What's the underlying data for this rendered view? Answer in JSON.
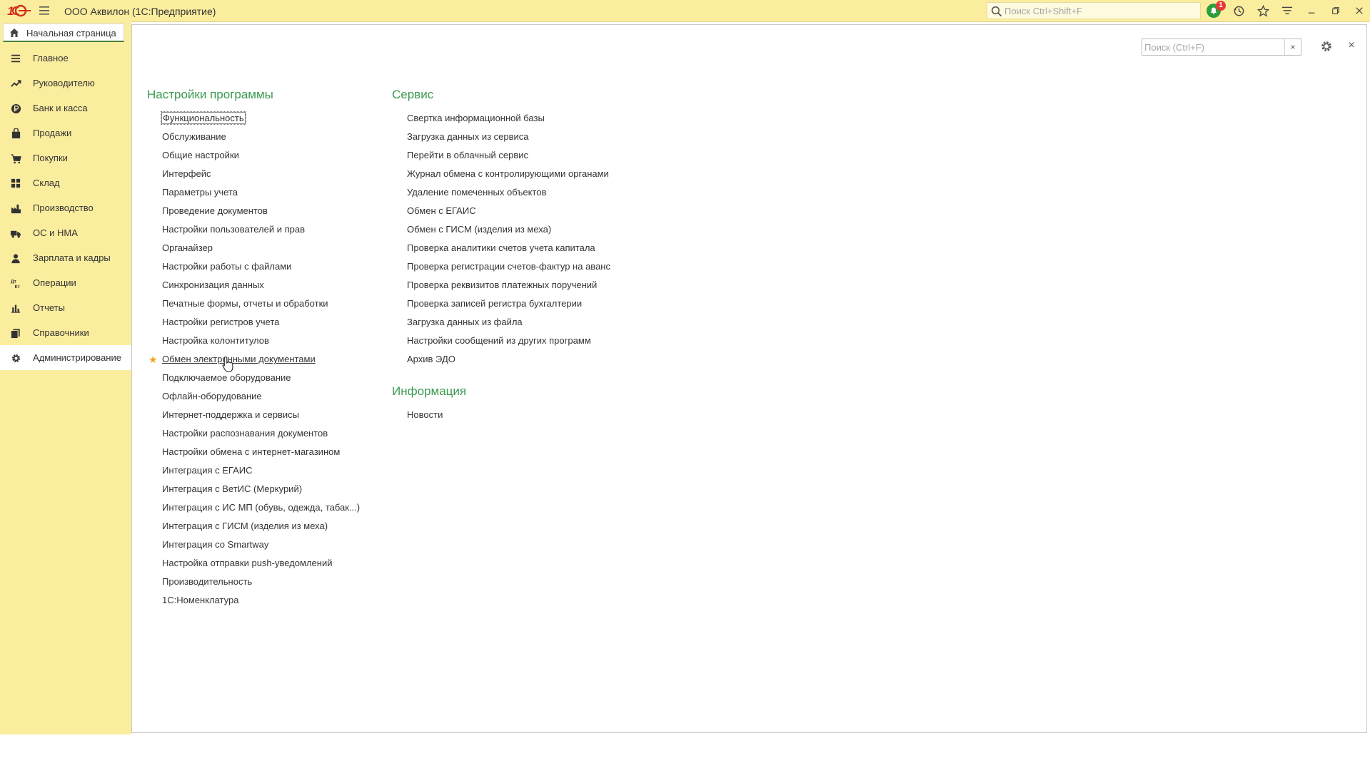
{
  "titlebar": {
    "app_title": "ООО Аквилон  (1С:Предприятие)",
    "search_placeholder": "Поиск Ctrl+Shift+F",
    "notification_count": "1",
    "brand_color": "#fbed9e"
  },
  "home_tab": {
    "label": "Начальная страница"
  },
  "sidebar": {
    "items": [
      {
        "label": "Главное",
        "icon": "menu-lines-icon"
      },
      {
        "label": "Руководителю",
        "icon": "trend-icon"
      },
      {
        "label": "Банк и касса",
        "icon": "ruble-icon"
      },
      {
        "label": "Продажи",
        "icon": "bag-icon"
      },
      {
        "label": "Покупки",
        "icon": "cart-icon"
      },
      {
        "label": "Склад",
        "icon": "grid-icon"
      },
      {
        "label": "Производство",
        "icon": "factory-icon"
      },
      {
        "label": "ОС и НМА",
        "icon": "truck-icon"
      },
      {
        "label": "Зарплата и кадры",
        "icon": "person-icon"
      },
      {
        "label": "Операции",
        "icon": "dt-kt-icon"
      },
      {
        "label": "Отчеты",
        "icon": "bar-chart-icon"
      },
      {
        "label": "Справочники",
        "icon": "books-icon"
      },
      {
        "label": "Администрирование",
        "icon": "gear-icon"
      }
    ],
    "active_index": 12
  },
  "panel": {
    "search_placeholder": "Поиск (Ctrl+F)",
    "clear_label": "×",
    "close_label": "×"
  },
  "sections": {
    "settings": {
      "title": "Настройки программы",
      "items": [
        "Функциональность",
        "Обслуживание",
        "Общие настройки",
        "Интерфейс",
        "Параметры учета",
        "Проведение документов",
        "Настройки пользователей и прав",
        "Органайзер",
        "Настройки работы с файлами",
        "Синхронизация данных",
        "Печатные формы, отчеты и обработки",
        "Настройки регистров учета",
        "Настройка колонтитулов",
        "Обмен электронными документами",
        "Подключаемое оборудование",
        "Офлайн-оборудование",
        "Интернет-поддержка и сервисы",
        "Настройки распознавания документов",
        "Настройки обмена с интернет-магазином",
        "Интеграция с ЕГАИС",
        "Интеграция с ВетИС (Меркурий)",
        "Интеграция с ИС МП (обувь, одежда, табак...)",
        "Интеграция с ГИСМ (изделия из меха)",
        "Интеграция со Smartway",
        "Настройка отправки push-уведомлений",
        "Производительность",
        "1С:Номенклатура"
      ]
    },
    "service": {
      "title": "Сервис",
      "items": [
        "Свертка информационной базы",
        "Загрузка данных из сервиса",
        "Перейти в облачный сервис",
        "Журнал обмена с контролирующими органами",
        "Удаление помеченных объектов",
        "Обмен с ЕГАИС",
        "Обмен с ГИСМ (изделия из меха)",
        "Проверка аналитики счетов учета капитала",
        "Проверка регистрации счетов-фактур на аванс",
        "Проверка реквизитов платежных поручений",
        "Проверка записей регистра бухгалтерии",
        "Загрузка данных из файла",
        "Настройки сообщений из других программ",
        "Архив ЭДО"
      ]
    },
    "info": {
      "title": "Информация",
      "items": [
        "Новости"
      ]
    }
  },
  "colors": {
    "section_title": "#3b9a50",
    "favorite_star": "#f4a11c"
  }
}
